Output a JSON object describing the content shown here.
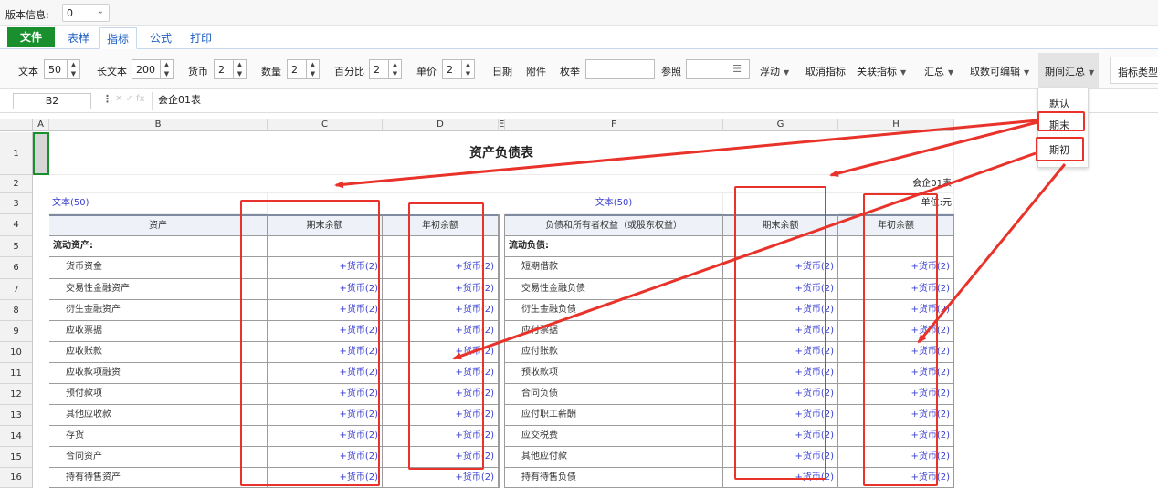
{
  "version": {
    "label": "版本信息:",
    "value": "0"
  },
  "menu": {
    "file": "文件",
    "tabs": [
      "表样",
      "指标",
      "公式",
      "打印"
    ],
    "active": "指标"
  },
  "toolbar": {
    "text_label": "文本",
    "text_value": "50",
    "longtext_label": "长文本",
    "longtext_value": "200",
    "currency_label": "货币",
    "currency_value": "2",
    "quantity_label": "数量",
    "quantity_value": "2",
    "percent_label": "百分比",
    "percent_value": "2",
    "price_label": "单价",
    "price_value": "2",
    "date": "日期",
    "attach": "附件",
    "enum": "枚举",
    "ref": "参照",
    "float": "浮动",
    "cancel_index": "取消指标",
    "related_index": "关联指标",
    "summary": "汇总",
    "fetch_editable": "取数可编辑",
    "period_summary": "期间汇总",
    "index_type": "指标类型"
  },
  "dropdown": {
    "items": [
      "默认",
      "期末",
      "期初"
    ]
  },
  "formula": {
    "cellref": "B2",
    "value": "会企01表"
  },
  "columns": [
    "A",
    "B",
    "C",
    "D",
    "E",
    "F",
    "G",
    "H"
  ],
  "sheet": {
    "title": "资产负债表",
    "code": "会企01表",
    "text50": "文本(50)",
    "unit": "单位:元",
    "headers": [
      "资产",
      "期末余额",
      "年初余额",
      "负债和所有者权益（或股东权益）",
      "期末余额",
      "年初余额"
    ],
    "section_left": "流动资产:",
    "section_right": "流动负债:",
    "currency": "+货币(2)",
    "left_items": [
      "货币资金",
      "交易性金融资产",
      "衍生金融资产",
      "应收票据",
      "应收账款",
      "应收款项融资",
      "预付款项",
      "其他应收款",
      "存货",
      "合同资产",
      "持有待售资产"
    ],
    "right_items": [
      "短期借款",
      "交易性金融负债",
      "衍生金融负债",
      "应付票据",
      "应付账款",
      "预收款项",
      "合同负债",
      "应付职工薪酬",
      "应交税费",
      "其他应付款",
      "持有待售负债"
    ],
    "row_numbers": [
      "1",
      "2",
      "3",
      "4",
      "5",
      "6",
      "7",
      "8",
      "9",
      "10",
      "11",
      "12",
      "13",
      "14",
      "15",
      "16"
    ]
  },
  "colors": {
    "annotation": "#e8322a",
    "accent": "#1f5fc4",
    "file_button": "#1a8f2e"
  }
}
